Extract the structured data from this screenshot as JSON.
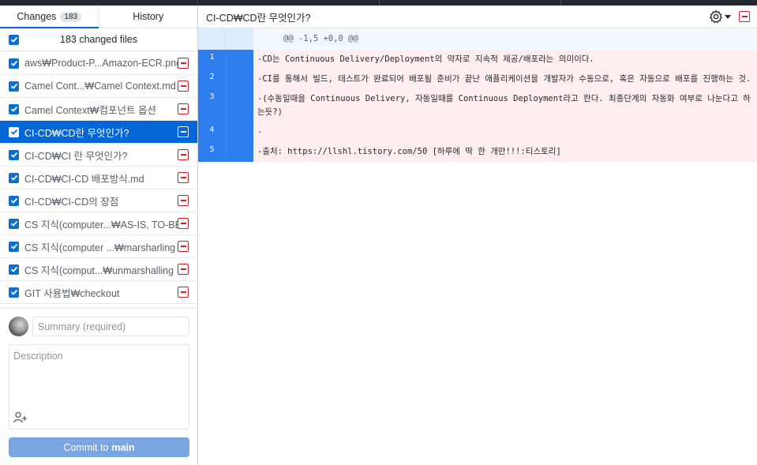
{
  "tabs": {
    "changes_label": "Changes",
    "changes_count": "183",
    "history_label": "History"
  },
  "changes_header": {
    "label": "183 changed files"
  },
  "files": [
    {
      "path": "aws₩Product-P...Amazon-ECR.png"
    },
    {
      "path": "Camel Cont...₩Camel Context.md"
    },
    {
      "path": "Camel Context₩컴포넌트 옵션"
    },
    {
      "path": "CI-CD₩CD란 무엇인가?"
    },
    {
      "path": "CI-CD₩CI 란 무엇인가?"
    },
    {
      "path": "CI-CD₩CI-CD 배포방식.md"
    },
    {
      "path": "CI-CD₩CI-CD의 장점"
    },
    {
      "path": "CS 지식(computer...₩AS-IS, TO-BE"
    },
    {
      "path": "CS 지식(computer ...₩marsharling"
    },
    {
      "path": "CS 지식(comput...₩unmarshalling"
    },
    {
      "path": "GIT 사용법₩checkout"
    }
  ],
  "commit": {
    "summary_placeholder": "Summary (required)",
    "description_placeholder": "Description",
    "button_prefix": "Commit to",
    "branch": "main"
  },
  "diff_view": {
    "file_title": "CI-CD₩CD란 무엇인가?",
    "hunk_header": "@@ -1,5 +0,0 @@",
    "lines": [
      {
        "num": "1",
        "text": "-CD는 Continuous Delivery/Deployment의 약자로 지속적 제공/배포라는 의미이다."
      },
      {
        "num": "2",
        "text": "-CI를 통해서 빌드, 테스트가 완료되어 배포될 준비가 끝난 애플리케이션을 개발자가 수동으로, 혹은 자동으로 배포를 진행하는 것."
      },
      {
        "num": "3",
        "text": "-(수동일때을 Continuous Delivery, 자동일때를 Continuous Deployment라고 한다. 최종단계의 자동화 여부로 나눈다고 하는듯?)"
      },
      {
        "num": "4",
        "text": "-"
      },
      {
        "num": "5",
        "text": "-출처: https://llshl.tistory.com/50 [하루에 딱 한 개만!!!:티스토리]"
      }
    ]
  },
  "colors": {
    "accent": "#0366d6",
    "deletion": "#cb2431",
    "deleted_line_bg": "#ffeef0",
    "line_number_bg": "#2e7ef0"
  },
  "icons": {
    "checkbox": "check-icon",
    "discard": "minus-square-icon",
    "settings": "gear-icon",
    "coauthor": "person-add-icon"
  }
}
